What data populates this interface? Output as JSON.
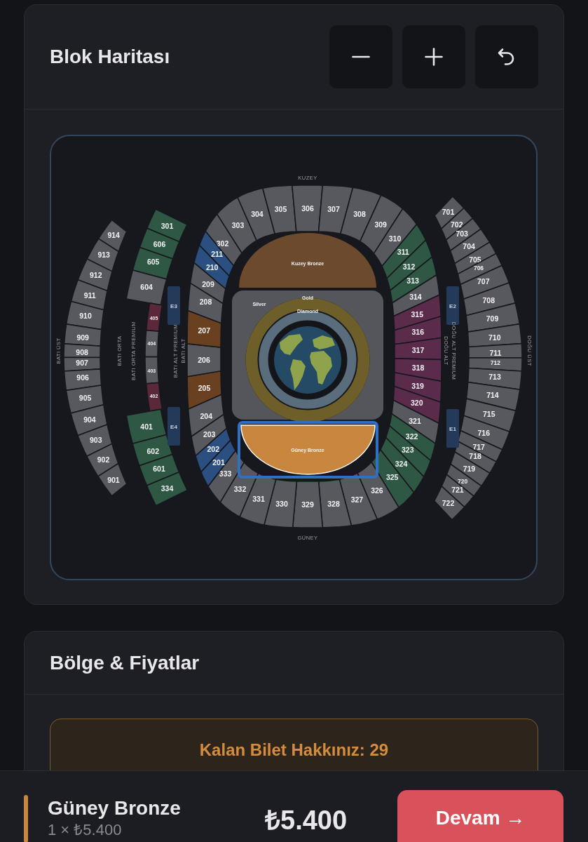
{
  "map_card": {
    "title": "Blok Haritası",
    "controls": [
      {
        "kind": "zoom_out"
      },
      {
        "kind": "zoom_in"
      },
      {
        "kind": "reset"
      }
    ]
  },
  "stand_labels": [
    "KUZEY",
    "BATI ÜST",
    "BATI ORTA",
    "BATI ORTA PREMIUM",
    "BATI ALT PREMIUM",
    "BATI ALT",
    "DOĞU ALT",
    "DOĞU ALT PREMIUM",
    "DOĞU ÜST",
    "GÜNEY"
  ],
  "entrances": [
    "E3",
    "E4",
    "E2",
    "E1"
  ],
  "outer_west_ring": [
    {
      "label": "914",
      "color": "#58595e"
    },
    {
      "label": "913",
      "color": "#58595e"
    },
    {
      "label": "912",
      "color": "#58595e"
    },
    {
      "label": "911",
      "color": "#58595e"
    },
    {
      "label": "910",
      "color": "#58595e"
    },
    {
      "label": "909",
      "color": "#58595e"
    },
    {
      "label": "908",
      "color": "#58595e"
    },
    {
      "label": "907",
      "color": "#58595e"
    },
    {
      "label": "906",
      "color": "#58595e"
    },
    {
      "label": "905",
      "color": "#58595e"
    },
    {
      "label": "904",
      "color": "#58595e"
    },
    {
      "label": "903",
      "color": "#58595e"
    },
    {
      "label": "902",
      "color": "#58595e"
    },
    {
      "label": "901",
      "color": "#58595e"
    }
  ],
  "middle_west_ring": [
    {
      "label": "301",
      "color": "#2e5744"
    },
    {
      "label": "606",
      "color": "#2e5744"
    },
    {
      "label": "605",
      "color": "#2e5744"
    },
    {
      "label": "604",
      "color": "#58595e"
    },
    {
      "label": "405",
      "color": "#5a2838"
    },
    {
      "label": "404",
      "color": "#58595e"
    },
    {
      "label": "403",
      "color": "#58595e"
    },
    {
      "label": "402",
      "color": "#5a2838"
    },
    {
      "label": "401",
      "color": "#2e5744"
    },
    {
      "label": "602",
      "color": "#2e5744"
    },
    {
      "label": "601",
      "color": "#2e5744"
    },
    {
      "label": "334",
      "color": "#2e5744"
    }
  ],
  "inner_ring_north": [
    {
      "label": "302",
      "color": "#58595e"
    },
    {
      "label": "303",
      "color": "#58595e"
    },
    {
      "label": "304",
      "color": "#58595e"
    },
    {
      "label": "305",
      "color": "#58595e"
    },
    {
      "label": "306",
      "color": "#58595e"
    },
    {
      "label": "307",
      "color": "#58595e"
    },
    {
      "label": "308",
      "color": "#58595e"
    },
    {
      "label": "309",
      "color": "#58595e"
    },
    {
      "label": "310",
      "color": "#58595e"
    },
    {
      "label": "311",
      "color": "#2e5744"
    },
    {
      "label": "312",
      "color": "#2e5744"
    },
    {
      "label": "313",
      "color": "#2e5744"
    },
    {
      "label": "314",
      "color": "#58595e"
    }
  ],
  "inner_ring_east": [
    {
      "label": "315",
      "color": "#5b2b4c"
    },
    {
      "label": "316",
      "color": "#5b2b4c"
    },
    {
      "label": "317",
      "color": "#5b2b4c"
    },
    {
      "label": "318",
      "color": "#5b2b4c"
    },
    {
      "label": "319",
      "color": "#5b2b4c"
    },
    {
      "label": "320",
      "color": "#5b2b4c"
    },
    {
      "label": "321",
      "color": "#58595e"
    },
    {
      "label": "322",
      "color": "#2e5744"
    },
    {
      "label": "323",
      "color": "#2e5744"
    },
    {
      "label": "324",
      "color": "#2e5744"
    },
    {
      "label": "325",
      "color": "#2e5744"
    }
  ],
  "inner_ring_south": [
    {
      "label": "333",
      "color": "#58595e"
    },
    {
      "label": "332",
      "color": "#58595e"
    },
    {
      "label": "331",
      "color": "#58595e"
    },
    {
      "label": "330",
      "color": "#58595e"
    },
    {
      "label": "329",
      "color": "#58595e"
    },
    {
      "label": "328",
      "color": "#58595e"
    },
    {
      "label": "327",
      "color": "#58595e"
    },
    {
      "label": "326",
      "color": "#58595e"
    }
  ],
  "inner_ring_west": [
    {
      "label": "211",
      "color": "#2a4f80"
    },
    {
      "label": "210",
      "color": "#2a4f80"
    },
    {
      "label": "209",
      "color": "#58595e"
    },
    {
      "label": "208",
      "color": "#58595e"
    },
    {
      "label": "207",
      "color": "#6a4120"
    },
    {
      "label": "206",
      "color": "#58595e"
    },
    {
      "label": "205",
      "color": "#6a4120"
    },
    {
      "label": "204",
      "color": "#58595e"
    },
    {
      "label": "203",
      "color": "#58595e"
    },
    {
      "label": "202",
      "color": "#2a4f80"
    },
    {
      "label": "201",
      "color": "#2a4f80"
    }
  ],
  "outer_east_ring": [
    {
      "label": "701",
      "color": "#58595e"
    },
    {
      "label": "702",
      "color": "#58595e"
    },
    {
      "label": "703",
      "color": "#58595e"
    },
    {
      "label": "704",
      "color": "#58595e"
    },
    {
      "label": "705",
      "color": "#58595e"
    },
    {
      "label": "706",
      "color": "#58595e"
    },
    {
      "label": "707",
      "color": "#58595e"
    },
    {
      "label": "708",
      "color": "#58595e"
    },
    {
      "label": "709",
      "color": "#58595e"
    },
    {
      "label": "710",
      "color": "#58595e"
    },
    {
      "label": "711",
      "color": "#58595e"
    },
    {
      "label": "712",
      "color": "#58595e"
    },
    {
      "label": "713",
      "color": "#58595e"
    },
    {
      "label": "714",
      "color": "#58595e"
    },
    {
      "label": "715",
      "color": "#58595e"
    },
    {
      "label": "716",
      "color": "#58595e"
    },
    {
      "label": "717",
      "color": "#58595e"
    },
    {
      "label": "718",
      "color": "#58595e"
    },
    {
      "label": "719",
      "color": "#58595e"
    },
    {
      "label": "720",
      "color": "#58595e"
    },
    {
      "label": "721",
      "color": "#58595e"
    },
    {
      "label": "722",
      "color": "#58595e"
    }
  ],
  "field_zones": [
    {
      "kind": "north_stand",
      "label": "Kuzey Bronze",
      "color": "#6b4a2e",
      "selected": false
    },
    {
      "kind": "silver",
      "label": "Silver",
      "color": "#55565b",
      "selected": false
    },
    {
      "kind": "gold",
      "label": "Gold",
      "color": "#6e5f2a",
      "selected": false
    },
    {
      "kind": "diamond",
      "label": "Diamond",
      "color": "#5a6d7c",
      "selected": false
    },
    {
      "kind": "south_stand",
      "label": "Güney Bronze",
      "color": "#c8863f",
      "selected": true
    }
  ],
  "prices_card": {
    "title": "Bölge & Fiyatlar",
    "notice": "Kalan Bilet Hakkınız: 29"
  },
  "summary": {
    "zone": "Güney Bronze",
    "color": "#c8863f",
    "quantity_price": "1 × ₺5.400",
    "total": "₺5.400",
    "button": "Devam →"
  }
}
